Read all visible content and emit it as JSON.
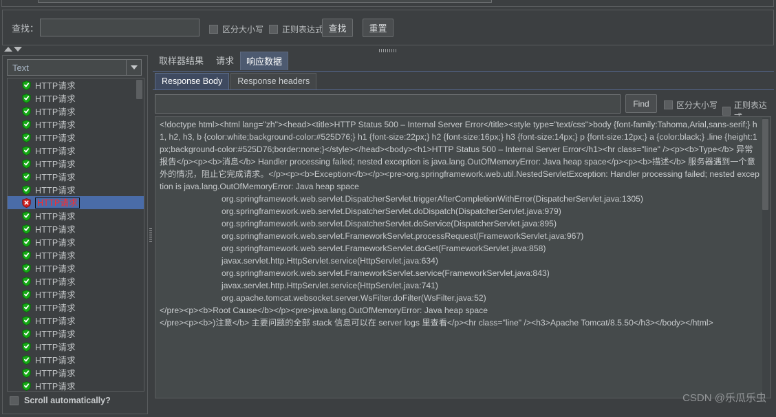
{
  "search_bar": {
    "label": "查找：",
    "input_value": "",
    "case_sensitive_label": "区分大小写",
    "regex_label": "正则表达式",
    "find_button": "查找",
    "reset_button": "重置"
  },
  "left_panel": {
    "combo_value": "Text",
    "scroll_auto_label": "Scroll automatically?",
    "tree_items": [
      {
        "label": "HTTP请求",
        "status": "ok",
        "selected": false
      },
      {
        "label": "HTTP请求",
        "status": "ok",
        "selected": false
      },
      {
        "label": "HTTP请求",
        "status": "ok",
        "selected": false
      },
      {
        "label": "HTTP请求",
        "status": "ok",
        "selected": false
      },
      {
        "label": "HTTP请求",
        "status": "ok",
        "selected": false
      },
      {
        "label": "HTTP请求",
        "status": "ok",
        "selected": false
      },
      {
        "label": "HTTP请求",
        "status": "ok",
        "selected": false
      },
      {
        "label": "HTTP请求",
        "status": "ok",
        "selected": false
      },
      {
        "label": "HTTP请求",
        "status": "ok",
        "selected": false
      },
      {
        "label": "HTTP请求",
        "status": "error",
        "selected": true
      },
      {
        "label": "HTTP请求",
        "status": "ok",
        "selected": false
      },
      {
        "label": "HTTP请求",
        "status": "ok",
        "selected": false
      },
      {
        "label": "HTTP请求",
        "status": "ok",
        "selected": false
      },
      {
        "label": "HTTP请求",
        "status": "ok",
        "selected": false
      },
      {
        "label": "HTTP请求",
        "status": "ok",
        "selected": false
      },
      {
        "label": "HTTP请求",
        "status": "ok",
        "selected": false
      },
      {
        "label": "HTTP请求",
        "status": "ok",
        "selected": false
      },
      {
        "label": "HTTP请求",
        "status": "ok",
        "selected": false
      },
      {
        "label": "HTTP请求",
        "status": "ok",
        "selected": false
      },
      {
        "label": "HTTP请求",
        "status": "ok",
        "selected": false
      },
      {
        "label": "HTTP请求",
        "status": "ok",
        "selected": false
      },
      {
        "label": "HTTP请求",
        "status": "ok",
        "selected": false
      },
      {
        "label": "HTTP请求",
        "status": "ok",
        "selected": false
      },
      {
        "label": "HTTP请求",
        "status": "ok",
        "selected": false
      }
    ]
  },
  "right_panel": {
    "top_tabs": [
      {
        "label": "取样器结果",
        "active": false
      },
      {
        "label": "请求",
        "active": false
      },
      {
        "label": "响应数据",
        "active": true
      }
    ],
    "sub_tabs": [
      {
        "label": "Response Body",
        "active": true
      },
      {
        "label": "Response headers",
        "active": false
      }
    ],
    "find_bar": {
      "input_value": "",
      "find_button": "Find",
      "case_sensitive_label": "区分大小写",
      "regex_label": "正则表达式"
    },
    "response_body": {
      "line_1": "<!doctype html><html lang=\"zh\"><head><title>HTTP Status 500 – Internal Server Error</title><style type=\"text/css\">body {font-family:Tahoma,Arial,sans-serif;} h1, h2, h3, b {color:white;background-color:#525D76;} h1 {font-size:22px;} h2 {font-size:16px;} h3 {font-size:14px;} p {font-size:12px;} a {color:black;} .line {height:1px;background-color:#525D76;border:none;}</style></head><body><h1>HTTP Status 500 – Internal Server Error</h1><hr class=\"line\" /><p><b>Type</b> 异常报告</p><p><b>消息</b> Handler processing failed; nested exception is java.lang.OutOfMemoryError: Java heap space</p><p><b>描述</b> 服务器遇到一个意外的情况，阻止它完成请求。</p><p><b>Exception</b></p><pre>org.springframework.web.util.NestedServletException: Handler processing failed; nested exception is java.lang.OutOfMemoryError: Java heap space",
      "stack_lines": [
        "org.springframework.web.servlet.DispatcherServlet.triggerAfterCompletionWithError(DispatcherServlet.java:1305)",
        "org.springframework.web.servlet.DispatcherServlet.doDispatch(DispatcherServlet.java:979)",
        "org.springframework.web.servlet.DispatcherServlet.doService(DispatcherServlet.java:895)",
        "org.springframework.web.servlet.FrameworkServlet.processRequest(FrameworkServlet.java:967)",
        "org.springframework.web.servlet.FrameworkServlet.doGet(FrameworkServlet.java:858)",
        "javax.servlet.http.HttpServlet.service(HttpServlet.java:634)",
        "org.springframework.web.servlet.FrameworkServlet.service(FrameworkServlet.java:843)",
        "javax.servlet.http.HttpServlet.service(HttpServlet.java:741)",
        "org.apache.tomcat.websocket.server.WsFilter.doFilter(WsFilter.java:52)"
      ],
      "root_cause_line": "</pre><p><b>Root Cause</b></p><pre>java.lang.OutOfMemoryError: Java heap space",
      "footer_line": "</pre><p><b>)注意</b> 主要问题的全部 stack 信息可以在 server logs 里查看</p><hr class=\"line\" /><h3>Apache Tomcat/8.5.50</h3></body></html>"
    }
  },
  "watermark": "CSDN @乐瓜乐虫",
  "colors": {
    "background": "#3c3f41",
    "selection_blue": "#4a6ca8",
    "active_tab": "#4d5a70",
    "error_red": "#ff2a2a",
    "ok_green": "#2bb32b",
    "text": "#c8cbcd"
  }
}
